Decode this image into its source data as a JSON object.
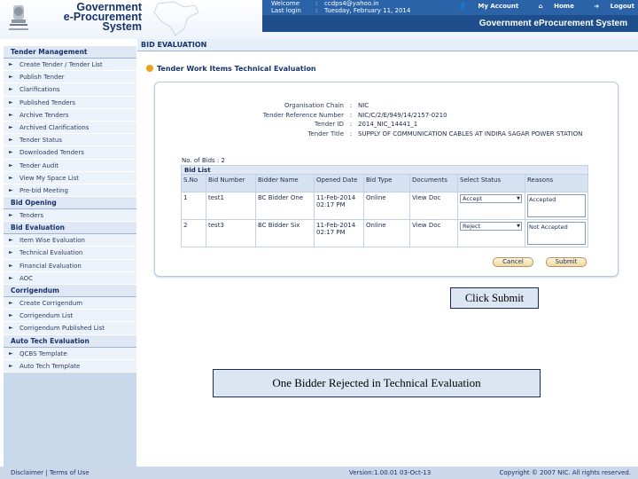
{
  "header": {
    "brand_lines": [
      "Government",
      "e-Procurement",
      "System"
    ],
    "user_info": [
      {
        "key": "Welcome",
        "value": "ccdps4@yahoo.in"
      },
      {
        "key": "Last login",
        "value": "Tuesday, February 11, 2014"
      }
    ],
    "links": {
      "my_account": "My Account",
      "home": "Home",
      "logout": "Logout"
    },
    "system_title": "Government eProcurement System"
  },
  "sidebar": {
    "sections": [
      {
        "title": "Tender Management",
        "items": [
          "Create Tender / Tender List",
          "Publish Tender",
          "Clarifications",
          "Published Tenders",
          "Archive Tenders",
          "Archived Clarifications",
          "Tender Status",
          "Downloaded Tenders",
          "Tender Audit",
          "View My Space List",
          "Pre-bid Meeting"
        ]
      },
      {
        "title": "Bid Opening",
        "items": [
          "Tenders"
        ]
      },
      {
        "title": "Bid Evaluation",
        "items": [
          "Item Wise Evaluation",
          "Technical Evaluation",
          "Financial Evaluation",
          "AOC"
        ]
      },
      {
        "title": "Corrigendum",
        "items": [
          "Create Corrigendum",
          "Corrigendum List",
          "Corrigendum Published List"
        ]
      },
      {
        "title": "Auto Tech Evaluation",
        "items": [
          "QCBS Template",
          "Auto Tech Template"
        ]
      }
    ]
  },
  "page": {
    "title": "BID EVALUATION",
    "section_title": "Tender Work Items Technical Evaluation"
  },
  "details": [
    {
      "label": "Organisation Chain",
      "value": "NIC"
    },
    {
      "label": "Tender Reference Number",
      "value": "NIC/C/2/E/949/14/2157-0210"
    },
    {
      "label": "Tender ID",
      "value": "2014_NIC_14441_1"
    },
    {
      "label": "Tender Title",
      "value": "SUPPLY OF COMMUNICATION CABLES AT INDIRA SAGAR POWER STATION"
    }
  ],
  "bids": {
    "count_label": "No. of Bids :",
    "count": "2",
    "list_title": "Bid List",
    "columns": [
      "S.No",
      "Bid Number",
      "Bidder Name",
      "Opened Date",
      "Bid Type",
      "Documents",
      "Select Status",
      "Reasons"
    ],
    "rows": [
      {
        "sno": "1",
        "bid_number": "test1",
        "bidder_name": "BC Bidder One",
        "opened_date": "11-Feb-2014 02:17 PM",
        "bid_type": "Online",
        "documents": "View Doc",
        "status": "Accept",
        "reason": "Accepted"
      },
      {
        "sno": "2",
        "bid_number": "test3",
        "bidder_name": "BC Bidder Six",
        "opened_date": "11-Feb-2014 02:17 PM",
        "bid_type": "Online",
        "documents": "View Doc",
        "status": "Reject",
        "reason": "Not Accepted"
      }
    ]
  },
  "buttons": {
    "cancel": "Cancel",
    "submit": "Submit"
  },
  "annotations": {
    "click_submit": "Click Submit",
    "one_bidder_rejected": "One Bidder Rejected in Technical Evaluation"
  },
  "footer": {
    "disclaimer": "Disclaimer",
    "separator": "|",
    "terms": "Terms of Use",
    "version": "Version:1.00.01 03-Oct-13",
    "copyright": "Copyright © 2007 NIC. All rights reserved."
  },
  "colors": {
    "header_blue": "#2a63a8",
    "sidebar": "#c9d9ec",
    "accent_orange": "#f0a020"
  }
}
